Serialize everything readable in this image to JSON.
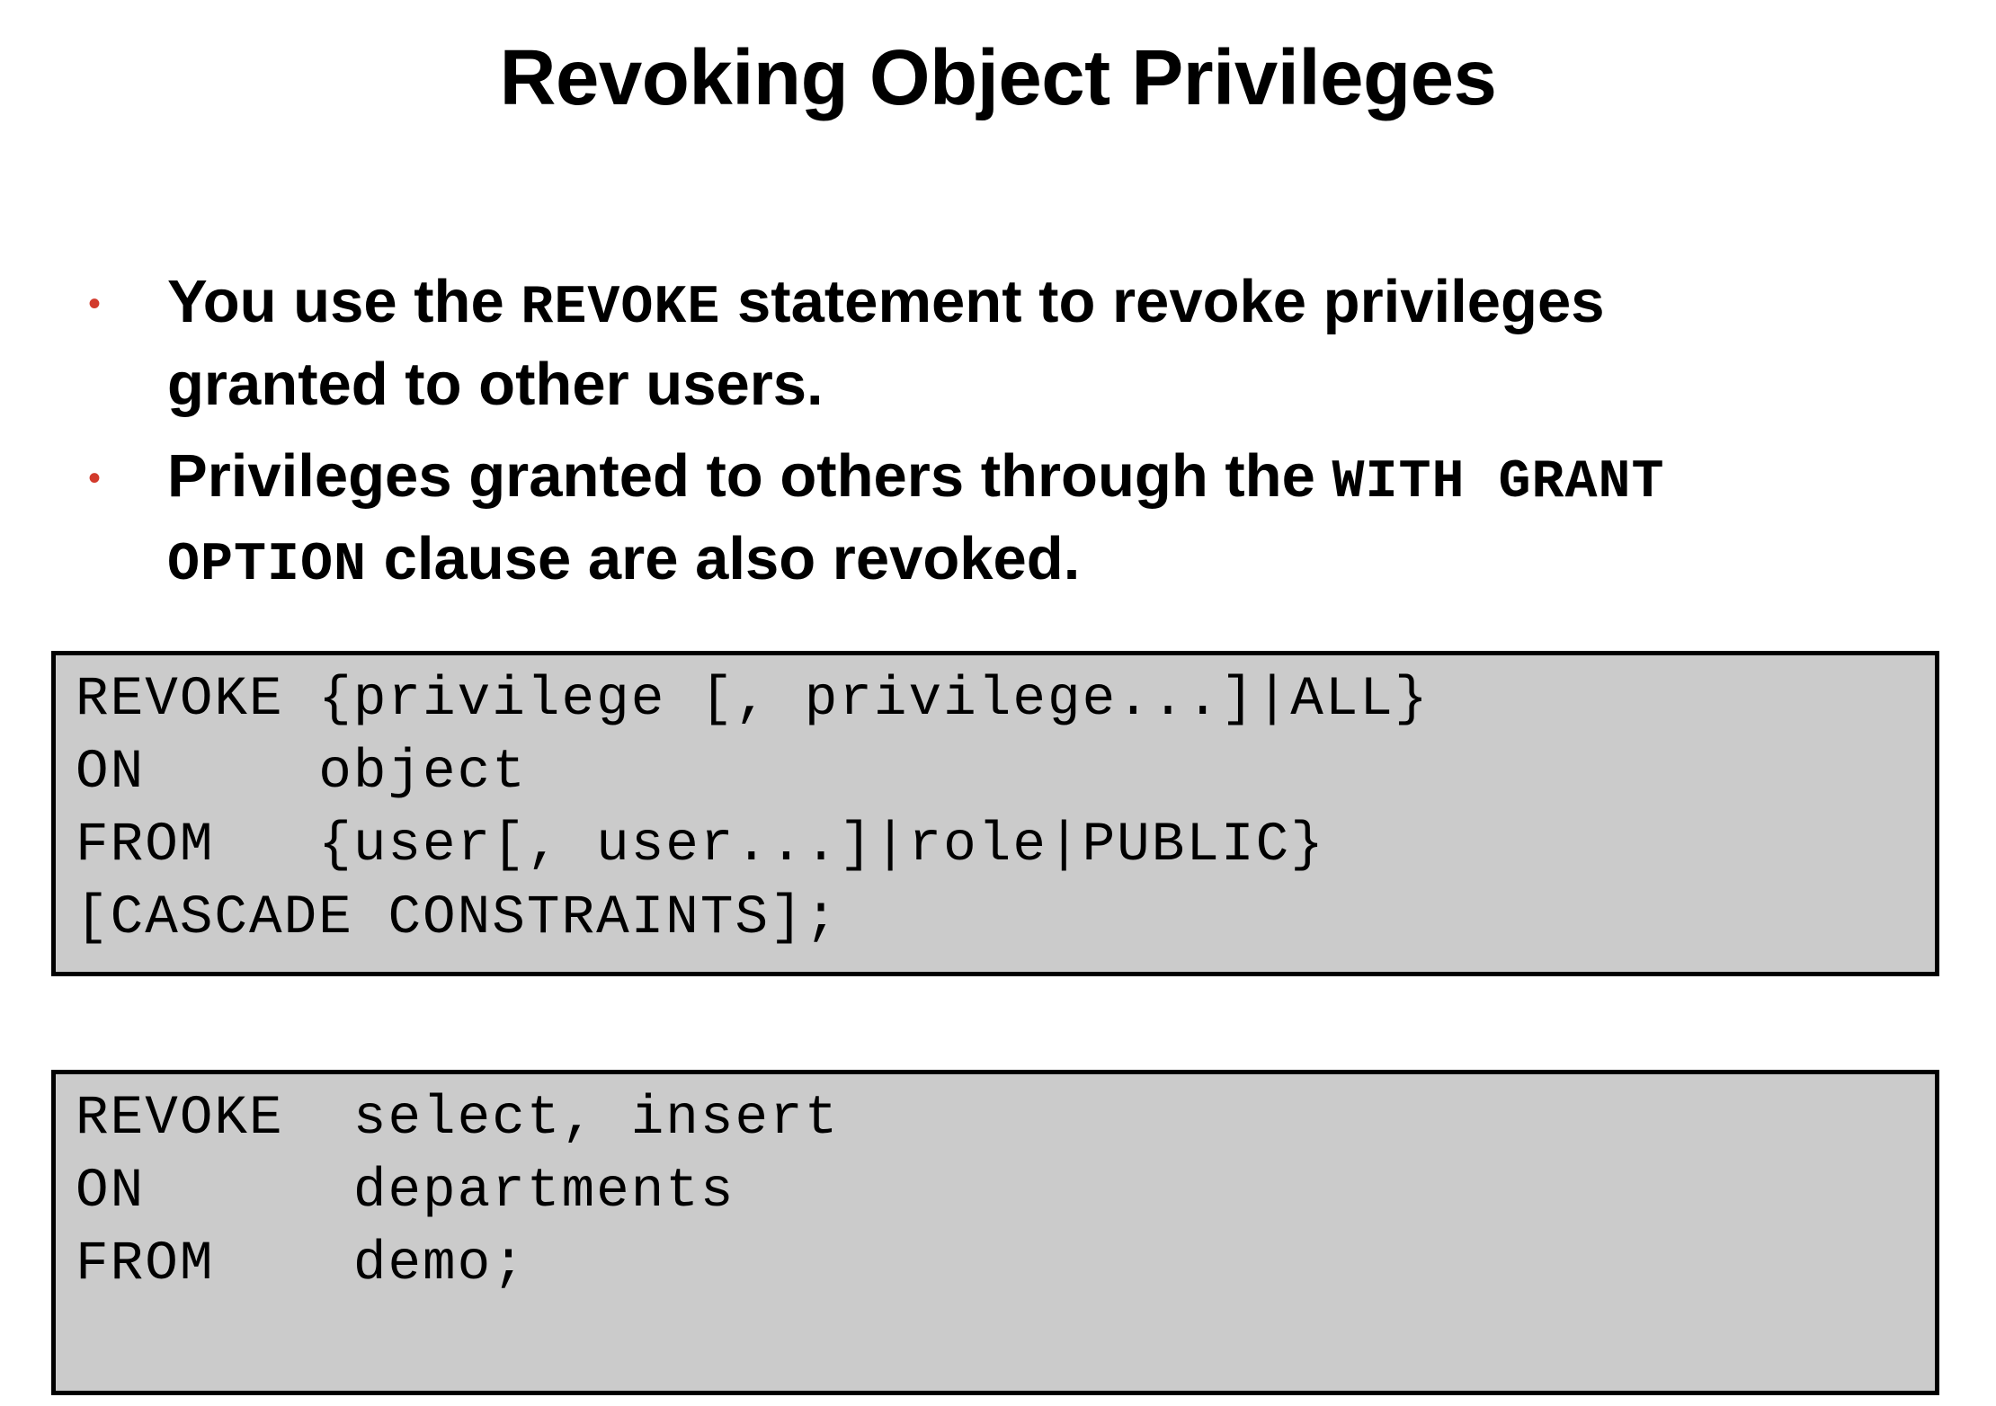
{
  "slide": {
    "title": "Revoking Object Privileges",
    "bullets": [
      {
        "parts": [
          {
            "text": "You use the ",
            "style": "sans"
          },
          {
            "text": "REVOKE",
            "style": "mono"
          },
          {
            "text": " statement to revoke privileges",
            "style": "sans"
          }
        ],
        "line2": [
          {
            "text": "granted to other users.",
            "style": "sans"
          }
        ]
      },
      {
        "parts": [
          {
            "text": "Privileges granted to others through the ",
            "style": "sans"
          },
          {
            "text": "WITH GRANT",
            "style": "mono"
          }
        ],
        "line2": [
          {
            "text": "OPTION",
            "style": "mono"
          },
          {
            "text": " clause are also revoked.",
            "style": "sans"
          }
        ]
      }
    ],
    "bullet_color": "#d23a2c",
    "syntax_box": {
      "lines": [
        "REVOKE {privilege [, privilege...]|ALL}",
        "ON     object",
        "FROM   {user[, user...]|role|PUBLIC}",
        "[CASCADE CONSTRAINTS];"
      ]
    },
    "example_box": {
      "lines": [
        "REVOKE  select, insert",
        "ON      departments",
        "FROM    demo;"
      ]
    },
    "box_fill": "#cbcbcb"
  }
}
